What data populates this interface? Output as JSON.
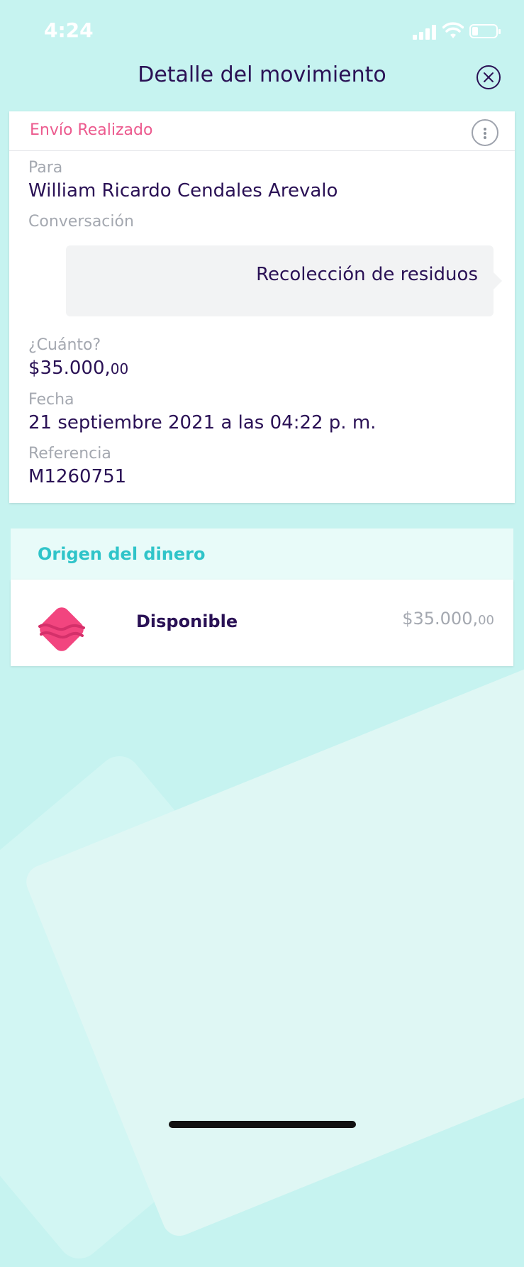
{
  "status_bar": {
    "time": "4:24"
  },
  "header": {
    "title": "Detalle del movimiento",
    "close_icon": "close-circle-icon"
  },
  "card": {
    "status": "Envío Realizado",
    "status_color": "#ec5a8e",
    "menu_icon": "more-vertical-icon",
    "to_label": "Para",
    "to_value": "William Ricardo Cendales Arevalo",
    "conversation_label": "Conversación",
    "message": "Recolección de residuos",
    "amount_label": "¿Cuánto?",
    "amount_main": "$35.000,",
    "amount_cents": "00",
    "date_label": "Fecha",
    "date_value": "21 septiembre 2021 a las 04:22 p. m.",
    "reference_label": "Referencia",
    "reference_value": "M1260751"
  },
  "origin": {
    "title": "Origen del dinero",
    "title_color": "#2fc4c9",
    "source_name": "Disponible",
    "source_icon": "disponible-logo-icon",
    "amount_main": "$35.000,",
    "amount_cents": "00"
  }
}
